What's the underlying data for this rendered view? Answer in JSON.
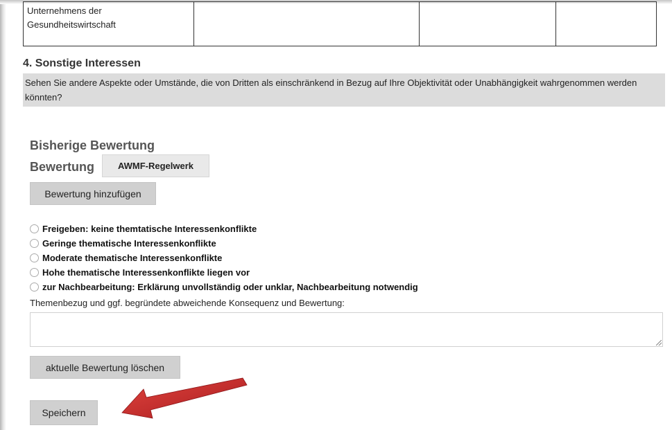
{
  "table": {
    "row": [
      "Unternehmens der Gesundheitswirtschaft",
      "",
      "",
      ""
    ]
  },
  "section": {
    "title": "4. Sonstige Interessen",
    "question": "Sehen Sie andere Aspekte oder Umstände, die von Dritten als einschränkend in Bezug auf Ihre Objektivität oder Unabhängigkeit wahrgenommen werden könnten?"
  },
  "evaluation": {
    "heading": "Bisherige Bewertung",
    "label": "Bewertung",
    "regelwerk_button": "AWMF-Regelwerk",
    "add_button": "Bewertung hinzufügen",
    "options": [
      "Freigeben: keine themtatische Interessenkonflikte",
      "Geringe thematische Interessenkonflikte",
      "Moderate thematische Interessenkonflikte",
      "Hohe thematische Interessenkonflikte liegen vor",
      "zur Nachbearbeitung: Erklärung unvollständig oder unklar, Nachbearbeitung notwendig"
    ],
    "reason_label": "Themenbezug und ggf. begründete abweichende Konsequenz und Bewertung:",
    "reason_value": "",
    "clear_button": "aktuelle Bewertung löschen",
    "save_button": "Speichern"
  },
  "colors": {
    "arrow": "#c8282a",
    "button_bg": "#d0d0d0",
    "question_bg": "#dcdcdc"
  }
}
